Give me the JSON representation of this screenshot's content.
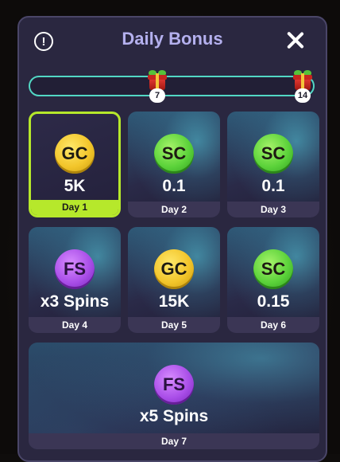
{
  "header": {
    "title": "Daily Bonus",
    "info_icon": "info-circle-icon",
    "close_icon": "close-icon"
  },
  "progress": {
    "milestones": [
      {
        "label": "7",
        "icon": "gift-icon"
      },
      {
        "label": "14",
        "icon": "gift-icon"
      }
    ]
  },
  "days": [
    {
      "coin": "GC",
      "amount": "5K",
      "day": "Day 1",
      "active": true,
      "coin_color": "#f2c52a"
    },
    {
      "coin": "SC",
      "amount": "0.1",
      "day": "Day 2",
      "active": false,
      "coin_color": "#5bd23a"
    },
    {
      "coin": "SC",
      "amount": "0.1",
      "day": "Day 3",
      "active": false,
      "coin_color": "#5bd23a"
    },
    {
      "coin": "FS",
      "amount": "x3 Spins",
      "day": "Day 4",
      "active": false,
      "coin_color": "#a94ee8"
    },
    {
      "coin": "GC",
      "amount": "15K",
      "day": "Day 5",
      "active": false,
      "coin_color": "#f2c52a"
    },
    {
      "coin": "SC",
      "amount": "0.15",
      "day": "Day 6",
      "active": false,
      "coin_color": "#5bd23a"
    },
    {
      "coin": "FS",
      "amount": "x5 Spins",
      "day": "Day 7",
      "active": false,
      "coin_color": "#a94ee8"
    }
  ],
  "colors": {
    "accent": "#b6e82b",
    "title": "#b4b0ee",
    "progress_border": "#52d7c4",
    "modal_bg": "#2a2740"
  }
}
